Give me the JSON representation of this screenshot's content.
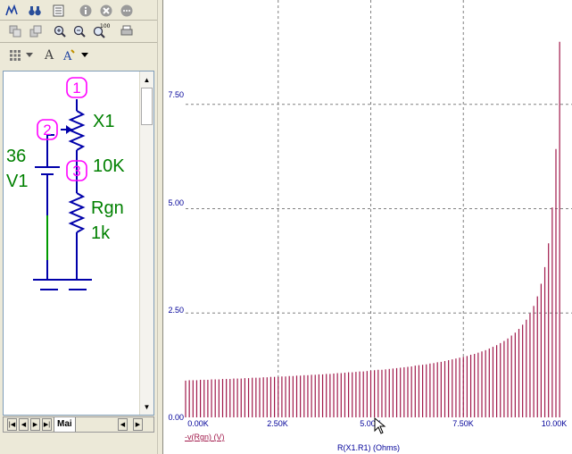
{
  "toolbar": {
    "row1_icons": [
      "probe-icon",
      "binoculars-icon",
      "list-icon",
      "info-icon",
      "close-icon",
      "more-icon"
    ],
    "row2_icons": [
      "copy-icon",
      "paste-icon",
      "zoom-in-icon",
      "zoom-out-icon",
      "zoom-100-icon",
      "print-icon"
    ],
    "zoom_badge": "100",
    "row3_icons": [
      "grid-icon",
      "dropdown-arrow-icon",
      "font-icon",
      "text-style-icon",
      "dropdown-arrow-icon"
    ]
  },
  "schematic": {
    "nodes": [
      "1",
      "2",
      "3"
    ],
    "potentiometer": {
      "ref": "X1",
      "value": "10K"
    },
    "battery": {
      "ref": "V1",
      "value": "36"
    },
    "resistor": {
      "ref": "Rgn",
      "value": "1k"
    },
    "colors": {
      "wire": "#0000aa",
      "label": "#008000",
      "node": "#ff00ff",
      "bar": "#a0184a"
    }
  },
  "tabs": {
    "active": "Mai",
    "nav_icons": [
      "first-icon",
      "prev-icon",
      "next-icon",
      "last-icon",
      "scroll-left-icon",
      "scroll-right-icon"
    ]
  },
  "chart_data": {
    "type": "bar",
    "x": {
      "min": 0,
      "max": 10000,
      "tick_labels": [
        "0.00K",
        "2.50K",
        "5.00K",
        "7.50K",
        "10.00K"
      ],
      "title": "R(X1.R1) (Ohms)"
    },
    "y": {
      "min": 0,
      "max": 10,
      "tick_labels": [
        "0.00",
        "2.50",
        "5.00",
        "7.50"
      ]
    },
    "series": [
      {
        "name": "-v(Rgn) (V)",
        "x_step": 100,
        "x_start": 0,
        "values": [
          0.88,
          0.89,
          0.89,
          0.89,
          0.9,
          0.9,
          0.9,
          0.91,
          0.91,
          0.91,
          0.92,
          0.92,
          0.92,
          0.93,
          0.93,
          0.93,
          0.94,
          0.94,
          0.95,
          0.95,
          0.95,
          0.96,
          0.96,
          0.97,
          0.97,
          0.97,
          0.98,
          0.98,
          0.99,
          0.99,
          1.0,
          1.0,
          1.01,
          1.01,
          1.02,
          1.02,
          1.03,
          1.03,
          1.04,
          1.04,
          1.05,
          1.06,
          1.06,
          1.07,
          1.08,
          1.08,
          1.09,
          1.1,
          1.1,
          1.11,
          1.12,
          1.13,
          1.14,
          1.14,
          1.15,
          1.16,
          1.17,
          1.18,
          1.19,
          1.2,
          1.21,
          1.22,
          1.24,
          1.25,
          1.26,
          1.27,
          1.29,
          1.3,
          1.32,
          1.33,
          1.35,
          1.37,
          1.39,
          1.41,
          1.43,
          1.45,
          1.47,
          1.5,
          1.52,
          1.55,
          1.58,
          1.61,
          1.65,
          1.69,
          1.73,
          1.78,
          1.83,
          1.89,
          1.96,
          2.03,
          2.12,
          2.22,
          2.34,
          2.49,
          2.67,
          2.9,
          3.2,
          3.6,
          4.17,
          5.03,
          6.43,
          9.0
        ]
      }
    ],
    "grid": true,
    "colors": {
      "bars": "#a0184a",
      "grid": "#808080",
      "axis_text": "#000099"
    }
  }
}
